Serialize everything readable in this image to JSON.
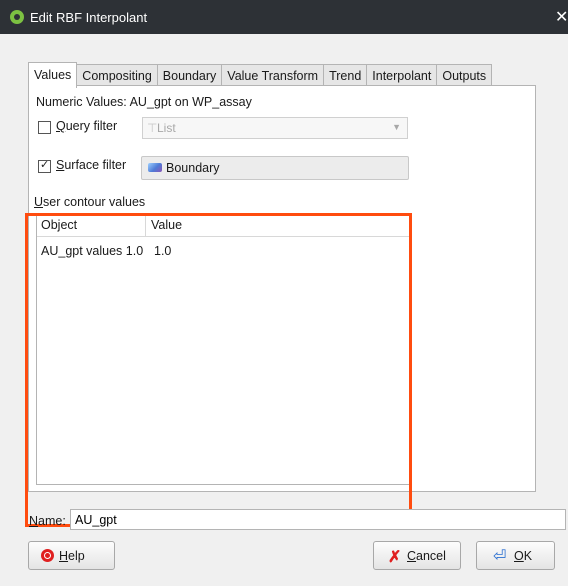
{
  "window": {
    "title": "Edit RBF Interpolant",
    "close_glyph": "✕"
  },
  "tabs": [
    {
      "label": "Values",
      "active": true
    },
    {
      "label": "Compositing"
    },
    {
      "label": "Boundary"
    },
    {
      "label": "Value Transform"
    },
    {
      "label": "Trend"
    },
    {
      "label": "Interpolant"
    },
    {
      "label": "Outputs"
    }
  ],
  "values": {
    "numeric_label": "Numeric Values:",
    "numeric_value": "AU_gpt on WP_assay",
    "query_filter": {
      "label_underlined": "Q",
      "label_rest": "uery filter",
      "checked": false,
      "combo_placeholder": "List",
      "enabled": false
    },
    "surface_filter": {
      "label_underlined": "S",
      "label_rest": "urface filter",
      "checked": true,
      "value": "Boundary"
    },
    "contours": {
      "label_underlined": "U",
      "label_rest": "ser contour values",
      "columns": [
        "Object",
        "Value"
      ],
      "rows": [
        {
          "object": "AU_gpt values 1.0",
          "value": "1.0"
        }
      ]
    }
  },
  "name": {
    "label_underlined": "N",
    "label_rest": "ame:",
    "value": "AU_gpt"
  },
  "buttons": {
    "help": {
      "underlined": "H",
      "rest": "elp"
    },
    "cancel": {
      "underlined": "C",
      "rest": "ancel"
    },
    "ok": {
      "underlined": "O",
      "rest": "K"
    }
  },
  "colors": {
    "highlight": "#ff4c0f",
    "titlebar": "#2d3136",
    "app_icon": "#7cc142"
  },
  "icons": {
    "app": "app-logo-icon",
    "funnel": "filter-icon",
    "boundary": "boundary-surface-icon",
    "help": "lifebuoy-icon",
    "cancel": "red-x-icon",
    "ok": "enter-arrow-icon"
  }
}
